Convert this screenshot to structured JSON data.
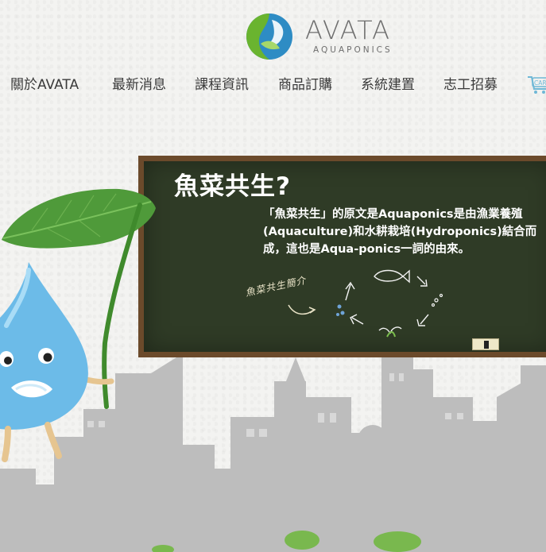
{
  "brand": {
    "name": "AVATA",
    "subtitle": "AQUAPONICS"
  },
  "nav": {
    "items": [
      {
        "label": "關於AVATA"
      },
      {
        "label": "最新消息"
      },
      {
        "label": "課程資訊"
      },
      {
        "label": "商品訂購"
      },
      {
        "label": "系統建置"
      },
      {
        "label": "志工招募"
      }
    ],
    "cart_label": "CART"
  },
  "board": {
    "title": "魚菜共生?",
    "text": "「魚菜共生」的原文是Aquaponics是由漁業養殖(Aquaculture)和水耕栽培(Hydroponics)結合而成，這也是Aqua-ponics一詞的由來。",
    "caption": "魚菜共生簡介"
  },
  "colors": {
    "board_green": "#2f3b26",
    "board_frame": "#6b4a2b",
    "leaf_green": "#4f9a3a",
    "drop_blue": "#5fb3e6",
    "city_gray": "#bdbdbd"
  }
}
